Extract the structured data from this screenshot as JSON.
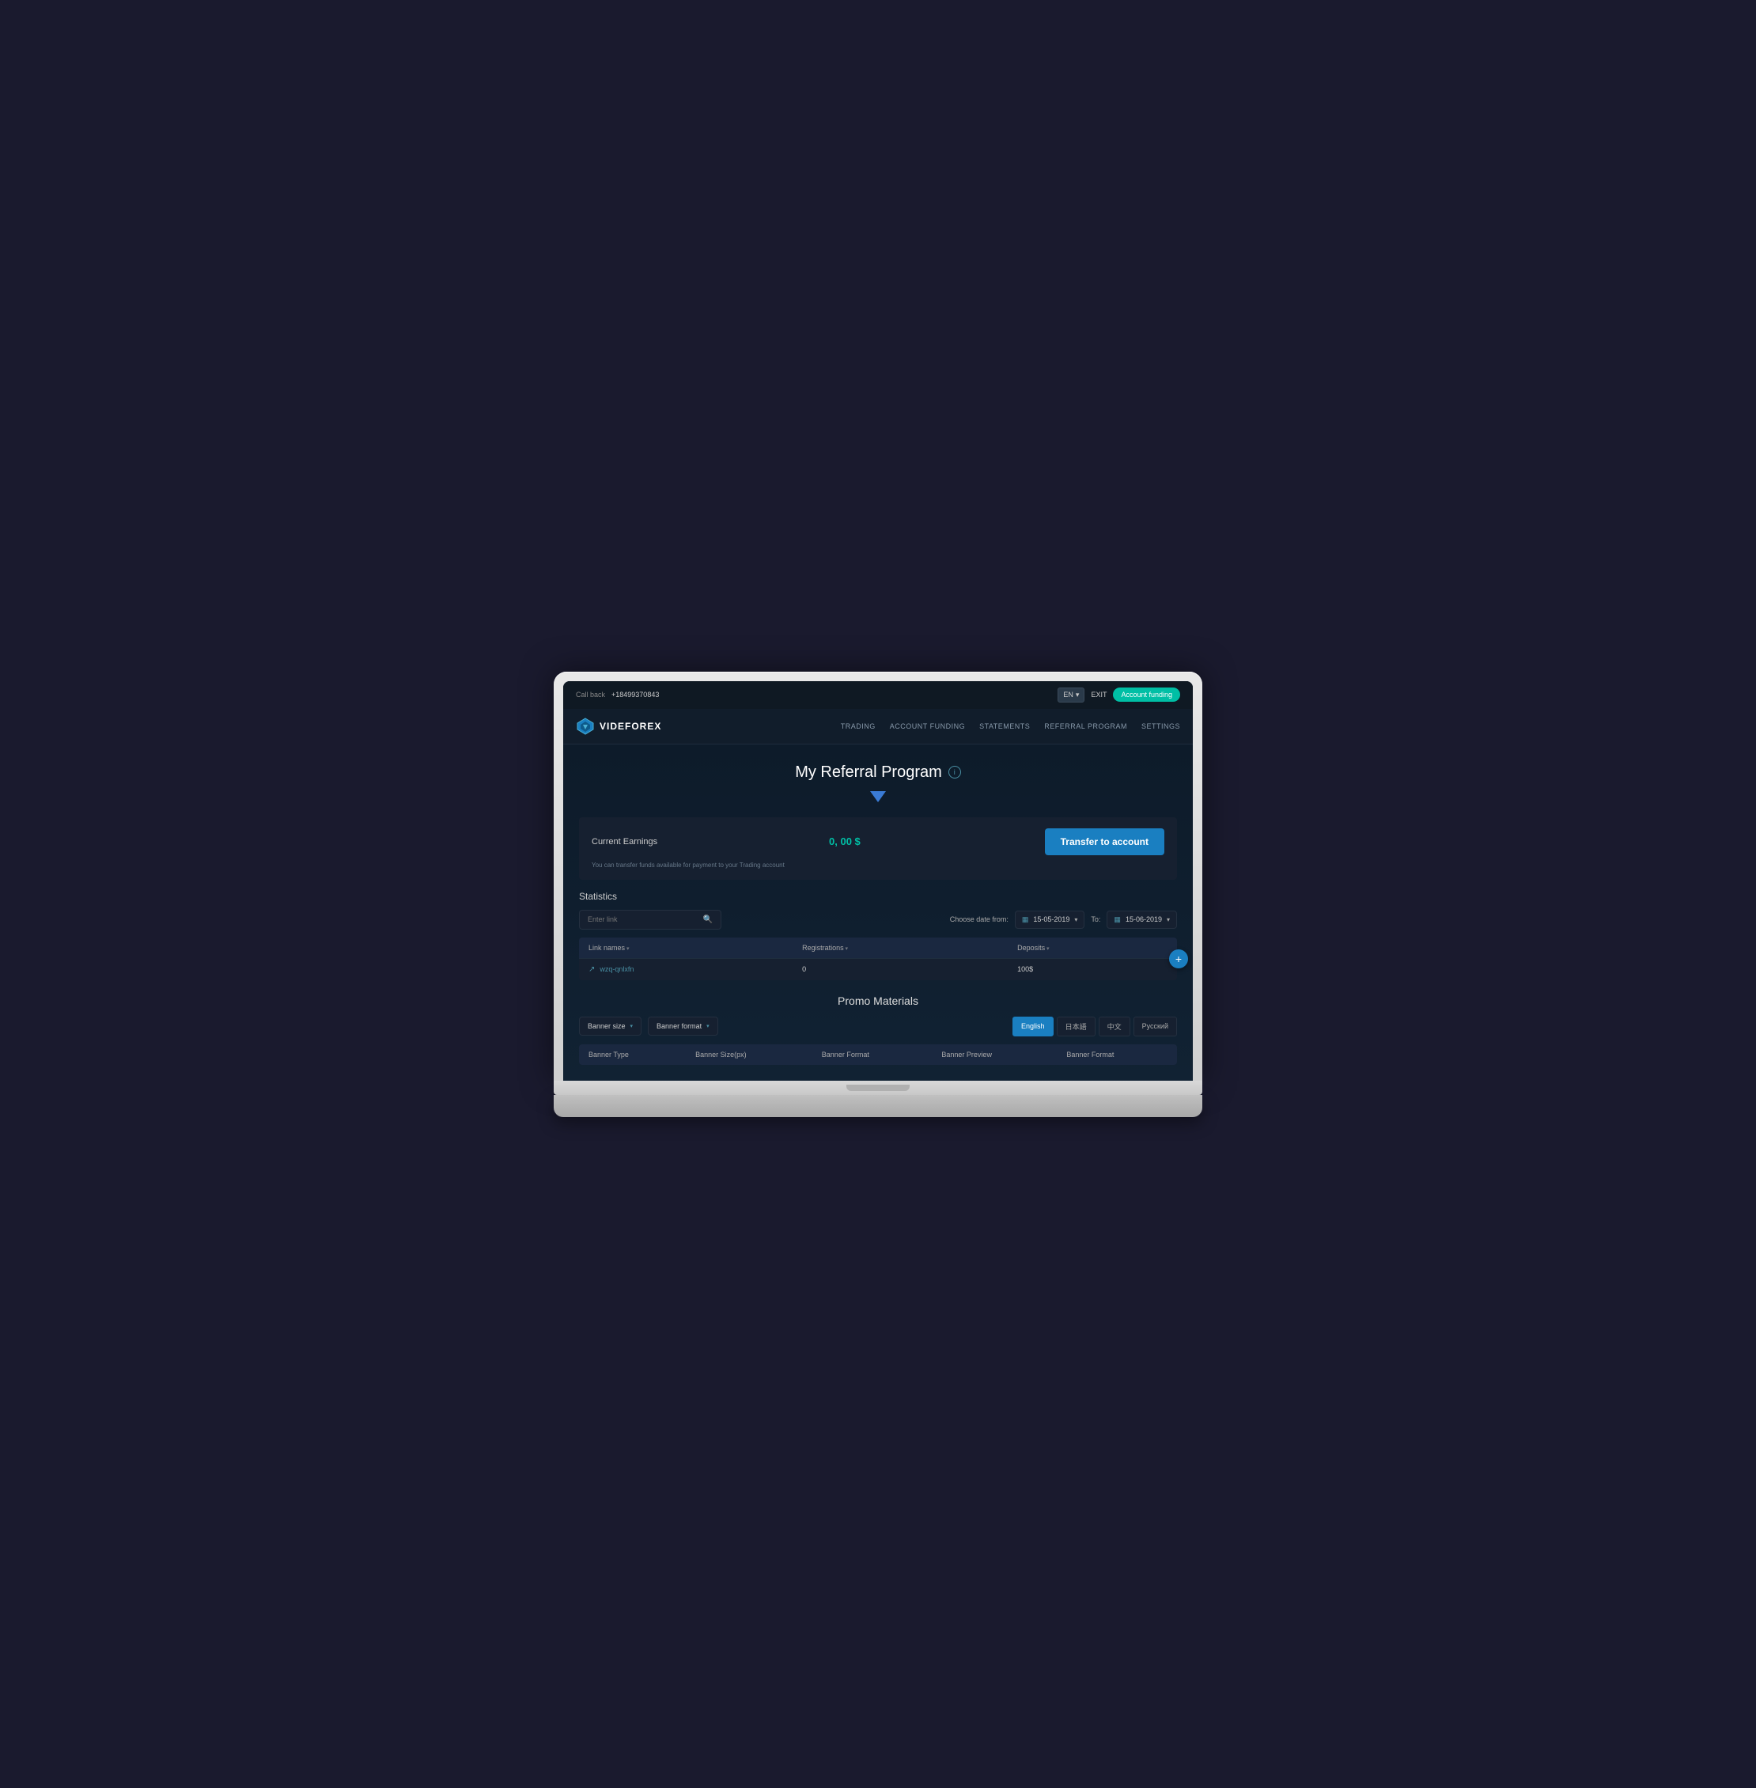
{
  "topbar": {
    "callback_label": "Call back",
    "phone": "+18499370843",
    "lang": "EN",
    "lang_arrow": "▾",
    "exit_label": "EXIT",
    "account_funding_label": "Account funding"
  },
  "nav": {
    "logo_text": "VIDEFOREX",
    "links": [
      {
        "id": "trading",
        "label": "TRADING"
      },
      {
        "id": "account-funding",
        "label": "ACCOUNT FUNDING"
      },
      {
        "id": "statements",
        "label": "STATEMENTS"
      },
      {
        "id": "referral-program",
        "label": "REFERRAL PROGRAM"
      },
      {
        "id": "settings",
        "label": "SETTINGS"
      }
    ]
  },
  "page": {
    "title": "My Referral Program",
    "info_icon": "i",
    "chevron": "▼"
  },
  "earnings": {
    "label": "Current Earnings",
    "value": "0, 00 $",
    "transfer_btn": "Transfer to account",
    "hint": "You can transfer funds available for payment to your Trading account"
  },
  "statistics": {
    "title": "Statistics",
    "search_placeholder": "Enter link",
    "date_from_label": "Choose date from:",
    "date_from": "15-05-2019",
    "date_to_label": "To:",
    "date_to": "15-06-2019",
    "columns": [
      {
        "id": "link-names",
        "label": "Link names"
      },
      {
        "id": "registrations",
        "label": "Registrations"
      },
      {
        "id": "deposits",
        "label": "Deposits"
      }
    ],
    "rows": [
      {
        "link": "wzq-qnlxfn",
        "registrations": "0",
        "deposits": "100$"
      }
    ],
    "add_btn": "+"
  },
  "promo": {
    "title": "Promo Materials",
    "banner_size_label": "Banner size",
    "banner_format_label": "Banner format",
    "languages": [
      {
        "id": "english",
        "label": "English",
        "active": true
      },
      {
        "id": "japanese",
        "label": "日本語",
        "active": false
      },
      {
        "id": "chinese",
        "label": "中文",
        "active": false
      },
      {
        "id": "russian",
        "label": "Русский",
        "active": false
      }
    ],
    "banner_columns": [
      {
        "id": "banner-type",
        "label": "Banner Type"
      },
      {
        "id": "banner-size-px",
        "label": "Banner Size(px)"
      },
      {
        "id": "banner-format",
        "label": "Banner Format"
      },
      {
        "id": "banner-preview",
        "label": "Banner Preview"
      },
      {
        "id": "banner-format-2",
        "label": "Banner Format"
      }
    ]
  }
}
